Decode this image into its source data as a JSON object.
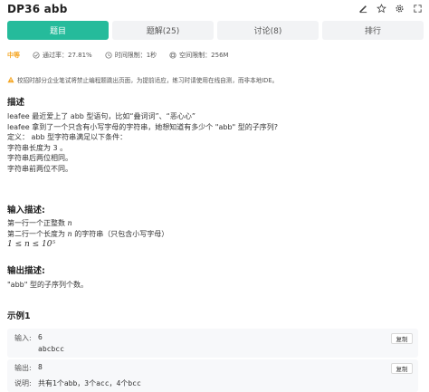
{
  "header": {
    "title": "DP36  abb",
    "icons": [
      "edit-icon",
      "star-icon",
      "settings-icon",
      "expand-icon"
    ]
  },
  "tabs": [
    {
      "label": "题目"
    },
    {
      "label": "题解(25)"
    },
    {
      "label": "讨论(8)"
    },
    {
      "label": "排行"
    }
  ],
  "meta": {
    "difficulty": "中等",
    "pass_rate": "通过率：27.81%",
    "time_limit": "时间限制：1秒",
    "memory_limit": "空间限制：256M"
  },
  "notice": "校招时部分企业笔试将禁止编程题跳出页面，为提前适应，练习时请使用在线自测，而非本地IDE。",
  "description": {
    "title": "描述",
    "lines": [
      "leafee 最近爱上了 abb 型语句，比如“叠词词”、“恶心心”",
      "leafee 拿到了一个只含有小写字母的字符串，她想知道有多少个 \"abb\" 型的子序列?",
      "定义： abb 型字符串满足以下条件：",
      "字符串长度为 3 。",
      "字符串后两位相同。",
      "字符串前两位不同。"
    ]
  },
  "input_desc": {
    "title": "输入描述:",
    "line1_pre": "第一行一个正整数 ",
    "line1_var": "n",
    "line2_pre": "第二行一个长度为 ",
    "line2_var": "n",
    "line2_post": " 的字符串（只包含小写字母）",
    "constraint": "1 ≤ n ≤ 10⁵"
  },
  "output_desc": {
    "title": "输出描述:",
    "line": "\"abb\" 型的子序列个数。"
  },
  "example": {
    "title": "示例1",
    "input_label": "输入:",
    "input_lines": [
      "6",
      "abcbcc"
    ],
    "output_label": "输出:",
    "output_value": "8",
    "explain_label": "说明:",
    "explain_value": "共有1个abb，3个acc，4个bcc",
    "copy_label": "复制"
  },
  "colors": {
    "accent": "#25bb9b",
    "difficulty": "#f5a623",
    "warning": "#f5a623"
  }
}
